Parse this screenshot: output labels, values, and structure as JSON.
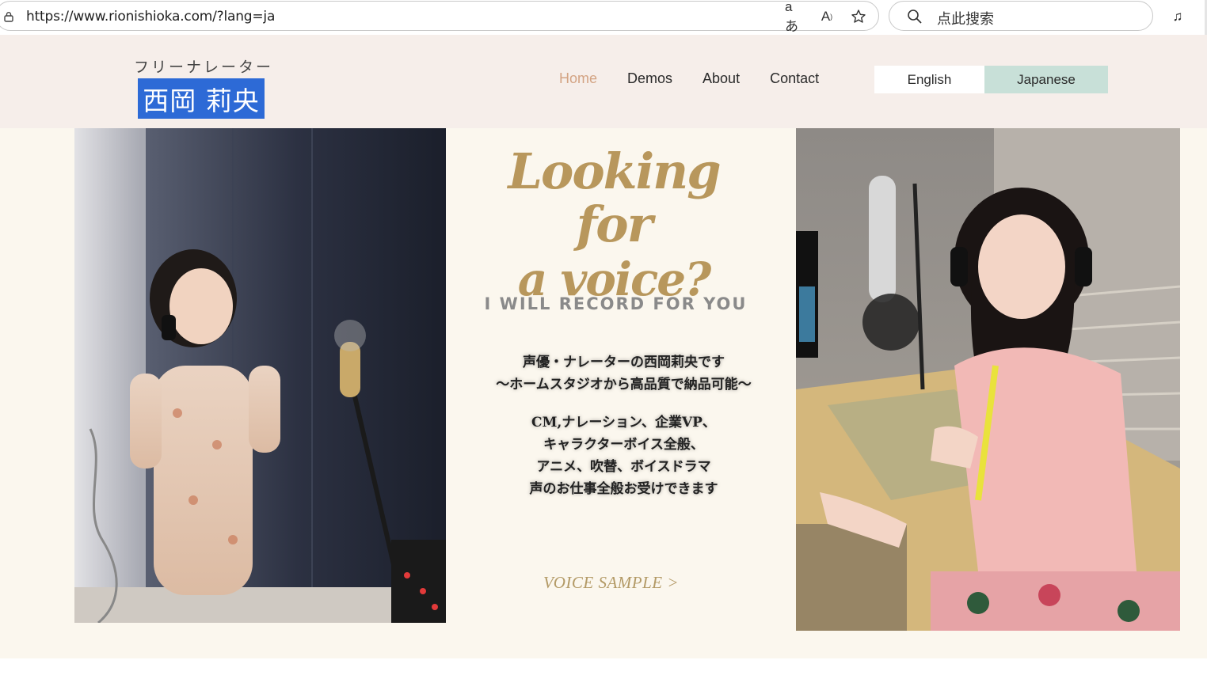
{
  "browser": {
    "url": "https://www.rionishioka.com/?lang=ja",
    "search_placeholder": "点此搜索",
    "icons": [
      "lock-icon",
      "read-aloud-icon",
      "translate-icon",
      "favorite-star-icon",
      "search-icon",
      "media-control-icon"
    ]
  },
  "header": {
    "tagline": "フリーナレーター",
    "name": "西岡 莉央",
    "nav": [
      {
        "label": "Home",
        "active": true
      },
      {
        "label": "Demos",
        "active": false
      },
      {
        "label": "About",
        "active": false
      },
      {
        "label": "Contact",
        "active": false
      }
    ],
    "lang_english": "English",
    "lang_japanese": "Japanese"
  },
  "hero": {
    "headline_line1": "Looking for",
    "headline_line2": "a voice?",
    "subhead": "I WILL RECORD FOR YOU",
    "intro_line1": "声優・ナレーターの西岡莉央です",
    "intro_line2": "〜ホームスタジオから高品質で納品可能〜",
    "services_line1": "CM,ナレーション、企業VP、",
    "services_line2": "キャラクターボイス全般、",
    "services_line3": "アニメ、吹替、ボイスドラマ",
    "services_line4": "声のお仕事全般お受けできます",
    "voice_sample": "VOICE SAMPLE >"
  },
  "colors": {
    "header_bg": "#f6eeea",
    "main_bg": "#fbf7ee",
    "nav_active": "#d3a383",
    "name_highlight": "#2d6ad6",
    "lang_active_bg": "#c8e0d8",
    "headline_gold": "#b8975c"
  }
}
